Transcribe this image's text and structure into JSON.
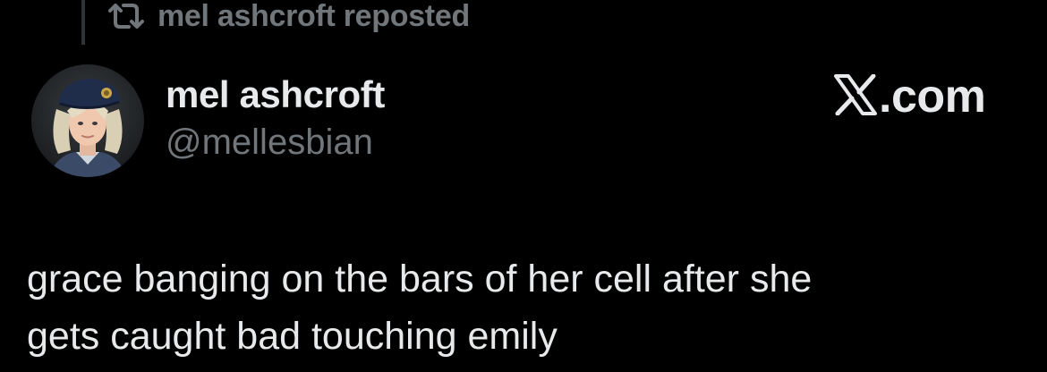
{
  "repost": {
    "icon": "repost-icon",
    "text": "mel ashcroft reposted"
  },
  "author": {
    "name": "mel ashcroft",
    "handle": "@mellesbian",
    "avatar_icon": "avatar"
  },
  "brand": {
    "label": ".com",
    "icon": "x-logo-icon"
  },
  "tweet": {
    "line1": "grace banging on the bars of her cell after she",
    "line2": "gets caught bad touching emily"
  },
  "colors": {
    "background": "#000000",
    "primary_text": "#e7e9ea",
    "secondary_text": "#71767b",
    "thread_line": "#2f3336"
  }
}
